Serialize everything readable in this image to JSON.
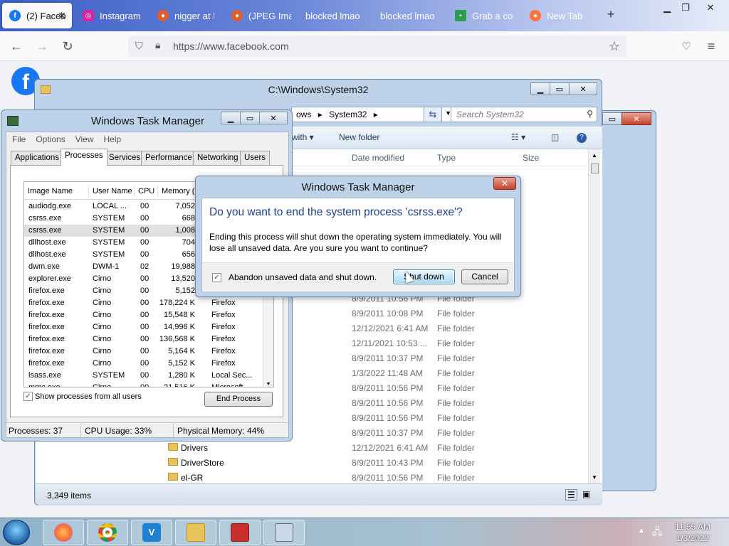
{
  "browser": {
    "tabs": [
      {
        "label": "(2) Faceb",
        "active": true,
        "icon": "facebook-icon",
        "color": "#1877f2"
      },
      {
        "label": "Instagram",
        "icon": "instagram-icon",
        "color": "#d6249f"
      },
      {
        "label": "nigger at D",
        "icon": "deviantart-icon",
        "color": "#e25b2a"
      },
      {
        "label": "(JPEG Imag",
        "icon": "deviantart-icon",
        "color": "#e25b2a"
      },
      {
        "label": "blocked lmao",
        "icon": "",
        "color": ""
      },
      {
        "label": "blocked lmao",
        "icon": "",
        "color": ""
      },
      {
        "label": "Grab a cool",
        "icon": "page-icon",
        "color": "#2e9c4f"
      },
      {
        "label": "New Tab",
        "icon": "firefox-icon",
        "color": "#ff7139"
      }
    ],
    "new_tab": "+",
    "url": "https://www.facebook.com",
    "fb_logo": "f"
  },
  "explorer": {
    "title": "C:\\Windows\\System32",
    "address_parts": [
      "ows",
      "System32"
    ],
    "search_placeholder": "Search System32",
    "toolbar": {
      "share_with": "with ▾",
      "new_folder": "New folder"
    },
    "columns": {
      "date": "Date modified",
      "type": "Type",
      "size": "Size"
    },
    "rows": [
      {
        "name": "",
        "date": "8/9/2011 10:56 PM",
        "type": "File folder"
      },
      {
        "name": "",
        "date": "8/9/2011 10:08 PM",
        "type": "File folder"
      },
      {
        "name": "",
        "date": "12/12/2021 6:41 AM",
        "type": "File folder"
      },
      {
        "name": "",
        "date": "12/11/2021 10:53 ...",
        "type": "File folder"
      },
      {
        "name": "",
        "date": "8/9/2011 10:37 PM",
        "type": "File folder"
      },
      {
        "name": "",
        "date": "1/3/2022 11:48 AM",
        "type": "File folder"
      },
      {
        "name": "",
        "date": "8/9/2011 10:56 PM",
        "type": "File folder"
      },
      {
        "name": "",
        "date": "8/9/2011 10:56 PM",
        "type": "File folder"
      },
      {
        "name": "",
        "date": "8/9/2011 10:56 PM",
        "type": "File folder"
      },
      {
        "name": "",
        "date": "8/9/2011 10:37 PM",
        "type": "File folder"
      },
      {
        "name": "Drivers",
        "date": "12/12/2021 6:41 AM",
        "type": "File folder"
      },
      {
        "name": "DriverStore",
        "date": "8/9/2011 10:43 PM",
        "type": "File folder"
      },
      {
        "name": "el-GR",
        "date": "8/9/2011 10:56 PM",
        "type": "File folder"
      }
    ],
    "status": "3,349 items"
  },
  "taskmgr": {
    "title": "Windows Task Manager",
    "menu": [
      "File",
      "Options",
      "View",
      "Help"
    ],
    "tabs": [
      "Applications",
      "Processes",
      "Services",
      "Performance",
      "Networking",
      "Users"
    ],
    "active_tab": "Processes",
    "columns": [
      "Image Name",
      "User Name",
      "CPU",
      "Memory (..."
    ],
    "processes": [
      {
        "name": "audiodg.exe",
        "user": "LOCAL ...",
        "cpu": "00",
        "mem": "7,052",
        "desc": ""
      },
      {
        "name": "csrss.exe",
        "user": "SYSTEM",
        "cpu": "00",
        "mem": "668",
        "desc": ""
      },
      {
        "name": "csrss.exe",
        "user": "SYSTEM",
        "cpu": "00",
        "mem": "1,008",
        "desc": "",
        "selected": true
      },
      {
        "name": "dllhost.exe",
        "user": "SYSTEM",
        "cpu": "00",
        "mem": "704",
        "desc": ""
      },
      {
        "name": "dllhost.exe",
        "user": "SYSTEM",
        "cpu": "00",
        "mem": "656",
        "desc": ""
      },
      {
        "name": "dwm.exe",
        "user": "DWM-1",
        "cpu": "02",
        "mem": "19,988",
        "desc": ""
      },
      {
        "name": "explorer.exe",
        "user": "Cirno",
        "cpu": "00",
        "mem": "13,520",
        "desc": ""
      },
      {
        "name": "firefox.exe",
        "user": "Cirno",
        "cpu": "00",
        "mem": "5,152",
        "desc": ""
      },
      {
        "name": "firefox.exe",
        "user": "Cirno",
        "cpu": "00",
        "mem": "178,224 K",
        "desc": "Firefox"
      },
      {
        "name": "firefox.exe",
        "user": "Cirno",
        "cpu": "00",
        "mem": "15,548 K",
        "desc": "Firefox"
      },
      {
        "name": "firefox.exe",
        "user": "Cirno",
        "cpu": "00",
        "mem": "14,996 K",
        "desc": "Firefox"
      },
      {
        "name": "firefox.exe",
        "user": "Cirno",
        "cpu": "00",
        "mem": "136,568 K",
        "desc": "Firefox"
      },
      {
        "name": "firefox.exe",
        "user": "Cirno",
        "cpu": "00",
        "mem": "5,164 K",
        "desc": "Firefox"
      },
      {
        "name": "firefox.exe",
        "user": "Cirno",
        "cpu": "00",
        "mem": "5,152 K",
        "desc": "Firefox"
      },
      {
        "name": "lsass.exe",
        "user": "SYSTEM",
        "cpu": "00",
        "mem": "1,280 K",
        "desc": "Local Sec..."
      },
      {
        "name": "mmc.exe",
        "user": "Cirno",
        "cpu": "00",
        "mem": "21,516 K",
        "desc": "Microsoft"
      }
    ],
    "show_all_users": "Show processes from all users",
    "end_process": "End Process",
    "status": {
      "processes": "Processes: 37",
      "cpu": "CPU Usage: 33%",
      "memory": "Physical Memory: 44%"
    }
  },
  "dialog": {
    "title": "Windows Task Manager",
    "question": "Do you want to end the system process 'csrss.exe'?",
    "detail": "Ending this process will shut down the operating system immediately.  You will lose all unsaved data.  Are you sure you want to continue?",
    "checkbox_label": "Abandon unsaved data and shut down.",
    "checkbox_checked": true,
    "shutdown_label": "Shut down",
    "cancel_label": "Cancel"
  },
  "taskbar": {
    "time": "11:55 AM",
    "date": "1/3/2022",
    "apps": [
      "firefox-icon",
      "chrome-icon",
      "vs-code-icon",
      "explorer-icon",
      "toolbox-icon",
      "task-manager-icon"
    ]
  }
}
